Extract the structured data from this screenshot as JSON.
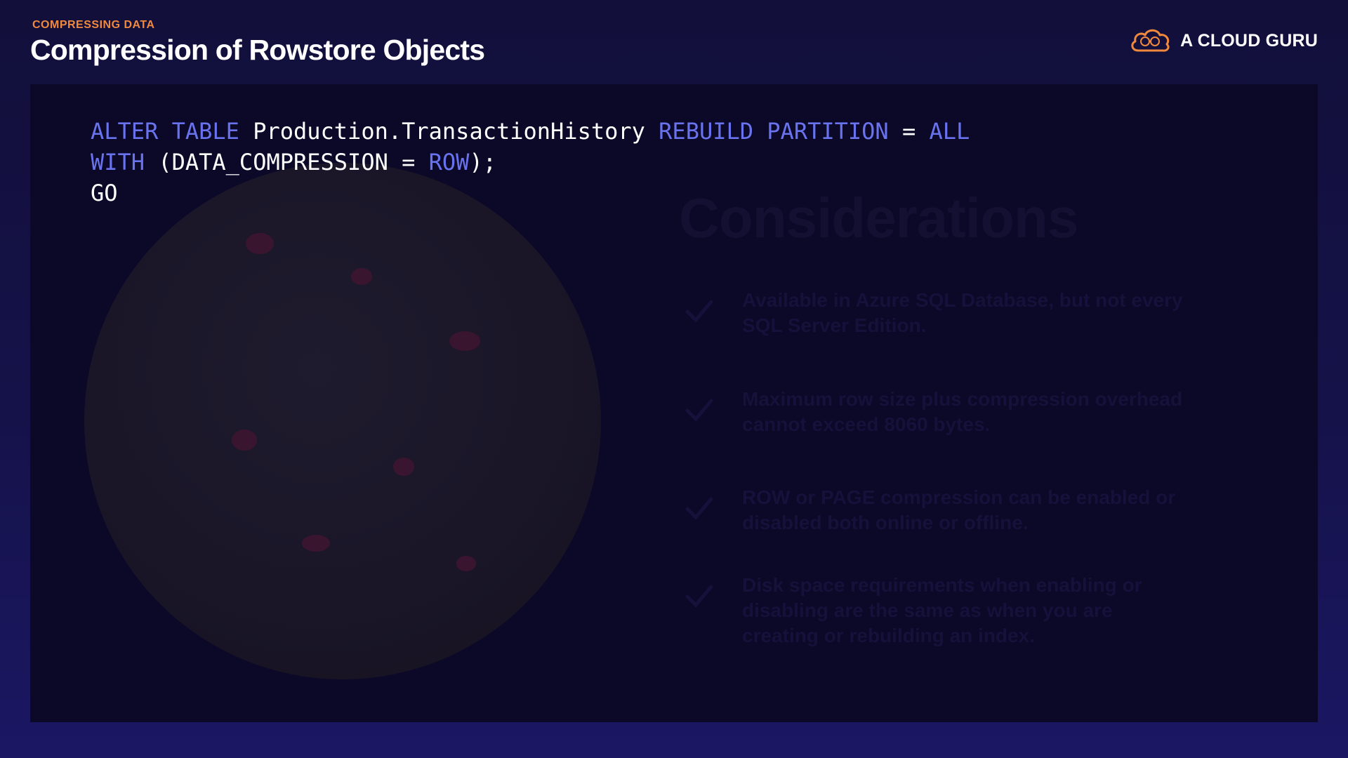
{
  "header": {
    "eyebrow": "COMPRESSING DATA",
    "title": "Compression of Rowstore Objects"
  },
  "brand": {
    "name": "A CLOUD GURU",
    "icon": "cloud-logo-icon",
    "color": "#f0893e"
  },
  "code": {
    "line1": {
      "kw1": "ALTER TABLE",
      "t1": " Production.TransactionHistory ",
      "kw2": "REBUILD PARTITION",
      "t2": " = ",
      "kw3": "ALL"
    },
    "line2": {
      "kw1": "WITH",
      "t1": " (DATA_COMPRESSION = ",
      "kw2": "ROW",
      "t2": ");"
    },
    "line3": "GO",
    "keyword_color": "#6a73ee"
  },
  "background_slide": {
    "title": "Considerations",
    "items": [
      "Available in Azure SQL Database, but not every SQL Server Edition.",
      "Maximum row size plus compression overhead cannot exceed 8060 bytes.",
      "ROW or PAGE compression can be enabled or disabled both online or offline.",
      "Disk space requirements when enabling or disabling are the same as when you are creating or rebuilding an index."
    ]
  }
}
